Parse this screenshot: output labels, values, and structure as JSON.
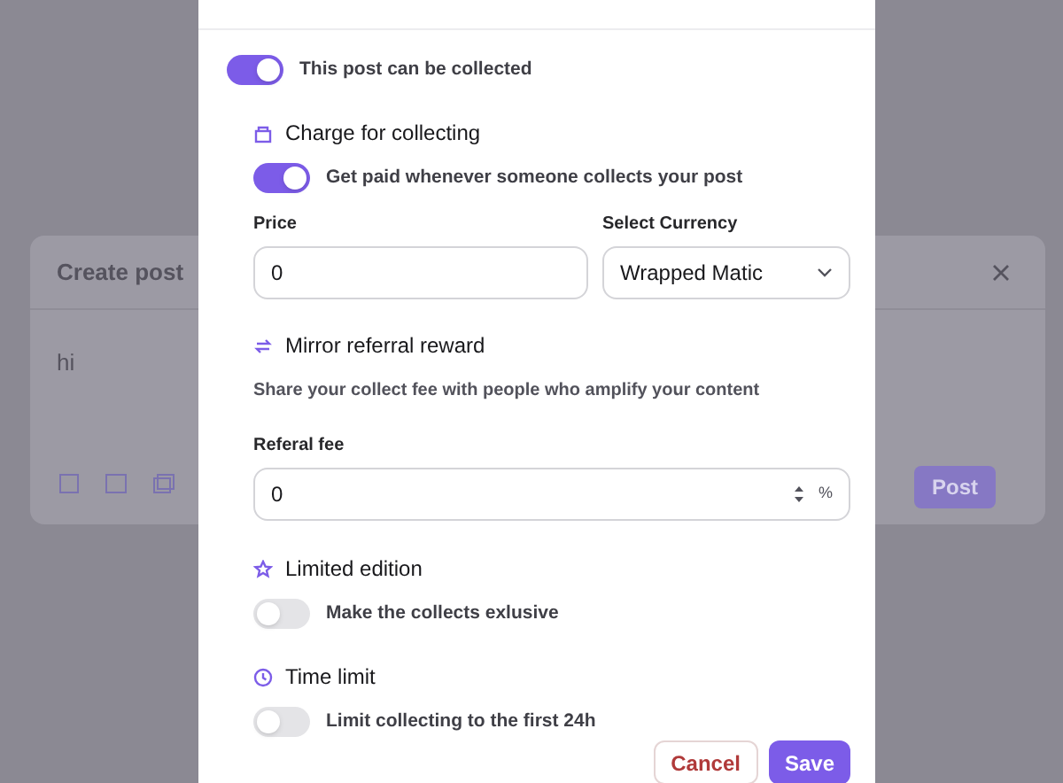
{
  "background": {
    "create_post": {
      "title": "Create post",
      "text": "hi",
      "post_button": "Post"
    }
  },
  "modal": {
    "collectible": {
      "label": "This post can be collected",
      "on": true
    },
    "sections": [
      {
        "kind": "charge",
        "title": "Charge for collecting",
        "toggle": {
          "label": "Get paid whenever someone collects your post",
          "on": true
        },
        "price": {
          "label": "Price",
          "value": "0"
        },
        "currency": {
          "label": "Select Currency",
          "value": "Wrapped Matic"
        }
      },
      {
        "kind": "referral",
        "title": "Mirror referral reward",
        "description": "Share your collect fee with people who amplify your content",
        "fee": {
          "label": "Referal fee",
          "value": "0",
          "unit": "%"
        }
      },
      {
        "kind": "limited",
        "title": "Limited edition",
        "toggle": {
          "label": "Make the collects exlusive",
          "on": false
        }
      },
      {
        "kind": "time",
        "title": "Time limit",
        "toggle": {
          "label": "Limit collecting to the first 24h",
          "on": false
        }
      }
    ],
    "buttons": [
      {
        "label": "Cancel",
        "kind": "secondary"
      },
      {
        "label": "Save",
        "kind": "primary"
      }
    ]
  }
}
